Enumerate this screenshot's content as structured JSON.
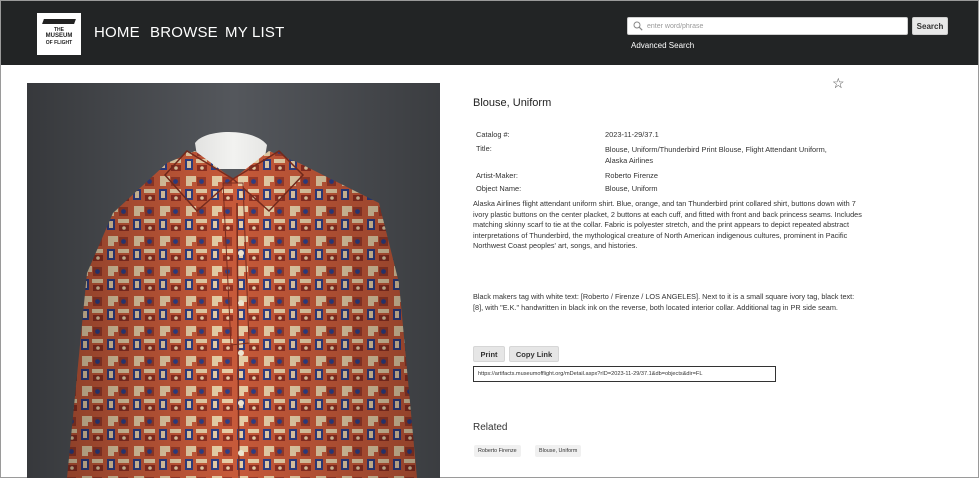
{
  "header": {
    "logo_text": [
      "THE",
      "MUSEUM",
      "OF FLIGHT"
    ],
    "nav": [
      {
        "label": "HOME"
      },
      {
        "label": "BROWSE"
      },
      {
        "label": "MY LIST"
      }
    ],
    "search": {
      "placeholder": "enter word/phrase",
      "value": "",
      "button_label": "Search",
      "advanced_label": "Advanced Search"
    }
  },
  "record": {
    "title": "Blouse, Uniform",
    "fields": [
      {
        "label": "Catalog #:",
        "value": "2023-11-29/37.1"
      },
      {
        "label": "Title:",
        "value": "Blouse, Uniform/Thunderbird Print Blouse, Flight Attendant Uniform, Alaska Airlines"
      },
      {
        "label": "Artist-Maker:",
        "value": "Roberto Firenze"
      },
      {
        "label": "Object Name:",
        "value": "Blouse, Uniform"
      }
    ],
    "description": [
      "Alaska Airlines flight attendant uniform shirt. Blue, orange, and tan Thunderbird print collared shirt, buttons down with 7 ivory plastic buttons on the center placket, 2 buttons at each cuff, and fitted with front and back princess seams. Includes matching skinny scarf to tie at the collar. Fabric is polyester stretch, and the print appears to depict repeated abstract interpretations of Thunderbird, the mythological creature of North American indigenous cultures, prominent in Pacific Northwest Coast peoples' art, songs, and histories.",
      "Black makers tag with white text: [Roberto / Firenze / LOS ANGELES]. Next to it is a small square ivory tag, black text: [8], with \"E.K.\" handwritten in black ink on the reverse, both located interior collar. Additional tag in PR side seam."
    ],
    "actions": {
      "print_label": "Print",
      "copy_label": "Copy Link",
      "link_url": "https://artifacts.museumofflight.org/mDetail.aspx?rID=2023-11-29/37.1&db=objects&dir=FL"
    },
    "related": {
      "heading": "Related",
      "tags": [
        "Roberto Firenze",
        "Blouse, Uniform"
      ]
    }
  },
  "icons": {
    "star": "star-outline-icon",
    "search": "search-icon"
  }
}
